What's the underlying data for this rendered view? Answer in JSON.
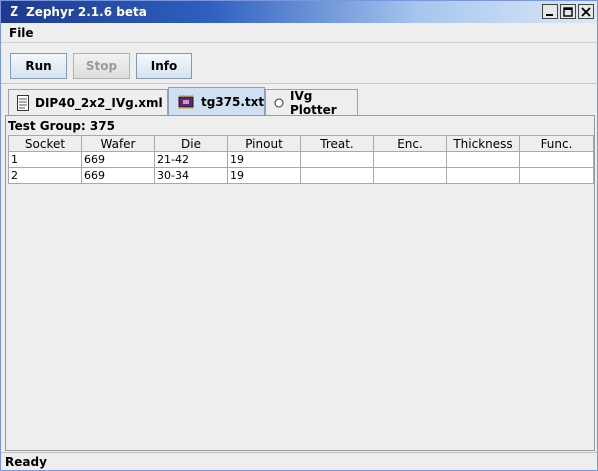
{
  "window": {
    "title": "Zephyr 2.1.6 beta",
    "app_icon": "Z"
  },
  "menu": {
    "items": [
      "File"
    ]
  },
  "toolbar": {
    "run_label": "Run",
    "stop_label": "Stop",
    "info_label": "Info"
  },
  "tabs": [
    {
      "label": "DIP40_2x2_IVg.xml",
      "icon": "document-icon",
      "active": false
    },
    {
      "label": "tg375.txt",
      "icon": "chip-icon",
      "active": true
    },
    {
      "label": "IVg Plotter",
      "icon": "radio-circle-icon",
      "active": false
    }
  ],
  "main": {
    "group_label": "Test Group: 375",
    "columns": [
      "Socket",
      "Wafer",
      "Die",
      "Pinout",
      "Treat.",
      "Enc.",
      "Thickness",
      "Func."
    ],
    "rows": [
      [
        "1",
        "669",
        "21-42",
        "19",
        "",
        "",
        "",
        ""
      ],
      [
        "2",
        "669",
        "30-34",
        "19",
        "",
        "",
        "",
        ""
      ]
    ]
  },
  "status": {
    "text": "Ready"
  },
  "colors": {
    "titlebar_start": "#1d3a8c",
    "titlebar_end": "#dde8f6",
    "active_tab": "#cfe0f3"
  }
}
